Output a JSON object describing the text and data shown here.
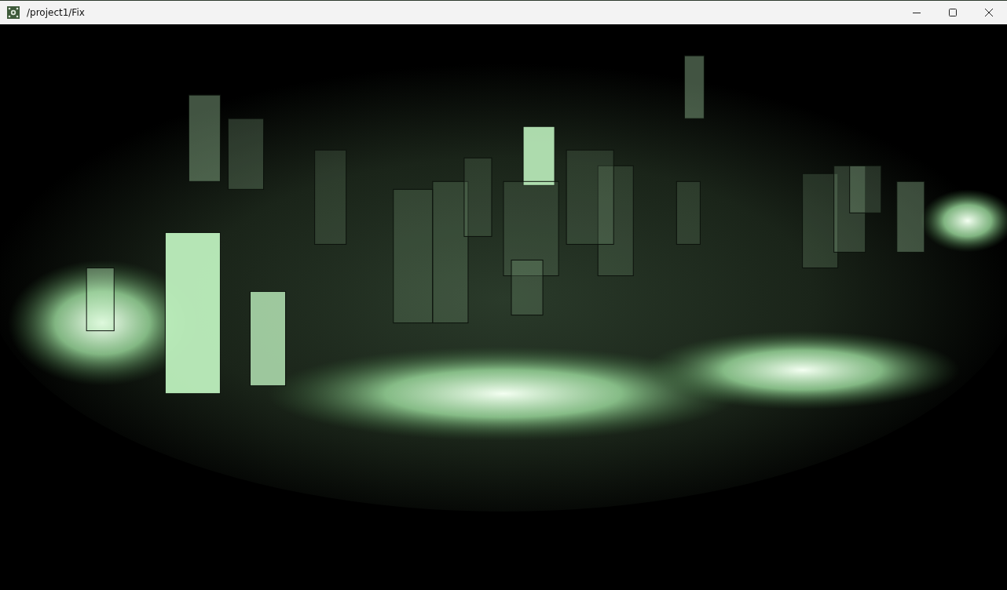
{
  "window": {
    "title": "/project1/Fix"
  }
}
